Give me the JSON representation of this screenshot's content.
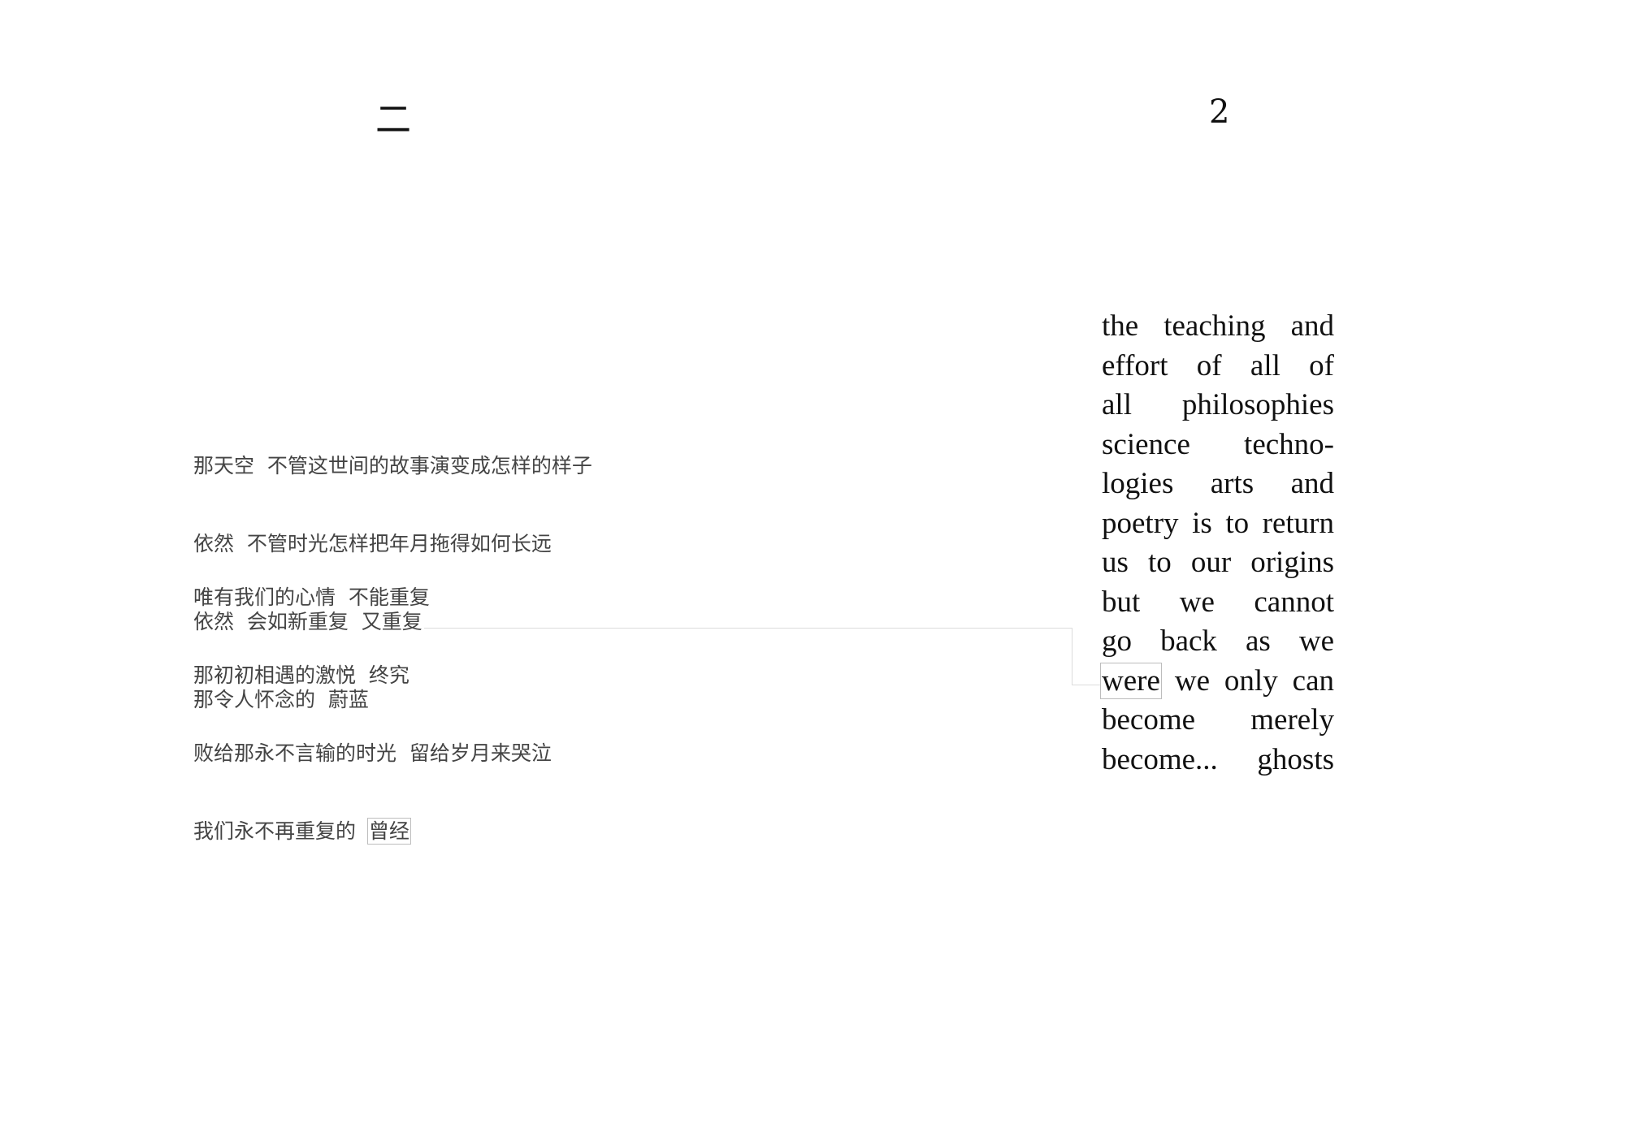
{
  "page_numbers": {
    "left": "二",
    "right": "2"
  },
  "chinese_poem": {
    "stanza_1": [
      "那天空  不管这世间的故事演变成怎样的样子",
      "依然  不管时光怎样把年月拖得如何长远",
      "依然  会如新重复  又重复",
      "那令人怀念的  蔚蓝"
    ],
    "stanza_2": [
      "唯有我们的心情  不能重复",
      "那初初相遇的激悦  终究",
      "败给那永不言输的时光  留给岁月来哭泣"
    ],
    "last_line_prefix": "我们永不再重复的  ",
    "highlighted_word": "曾经"
  },
  "english_poem": {
    "lines": [
      "the teaching and",
      "effort of all of",
      "all philosophies",
      "science techno-",
      "logies arts and",
      "poetry is to return",
      "us to our origins",
      "but we cannot",
      "go back as we"
    ],
    "highlighted_word": "were",
    "highlighted_line_rest": "we only can",
    "closing_lines": [
      "become merely",
      "become... ghosts"
    ]
  }
}
